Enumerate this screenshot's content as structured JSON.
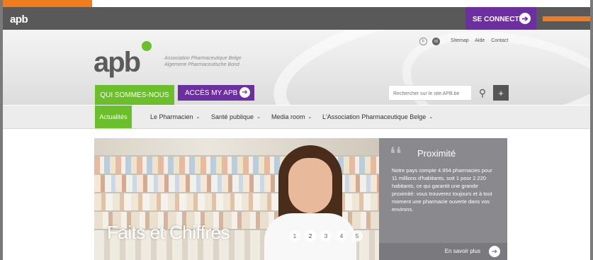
{
  "brand": {
    "short_logo": "apb",
    "logo": "apb",
    "assoc_fr": "Association Pharmaceutique Belge",
    "assoc_nl": "Algemene Pharmaceutische Bond",
    "colors": {
      "green": "#6bbf2a",
      "purple": "#6b2fa0",
      "orange": "#f07c20",
      "dark": "#595959"
    }
  },
  "topbar": {
    "connect_label": "SE CONNECTER",
    "arrow_icon": "arrow-right-icon"
  },
  "header": {
    "lang_fr": "fr",
    "lang_nl": "nl",
    "links": [
      "Sitemap",
      "Aide",
      "Contact"
    ],
    "tab_qui": "QUI SOMMES-NOUS",
    "tab_acces": "ACCÈS MY APB",
    "search_placeholder": "Rechercher sur le site APB.be",
    "plus": "+"
  },
  "nav": {
    "items": [
      {
        "label": "Actualités"
      },
      {
        "label": "Le Pharmacien"
      },
      {
        "label": "Santé publique"
      },
      {
        "label": "Media room"
      },
      {
        "label": "L'Association Pharmaceutique Belge"
      }
    ]
  },
  "hero": {
    "title": "Faits et Chiffres",
    "dots": [
      "1",
      "2",
      "3",
      "4",
      "5"
    ],
    "active_dot": 2
  },
  "info": {
    "quote": "❛❛",
    "title": "Proximité",
    "text": "Notre pays compte 4.954 pharmacies pour 11 millions d'habitants, soit 1 pour 2.220 habitants, ce qui garantit une grande proximité: vous trouverez toujours et à tout moment une pharmacie ouverte dans vos environs.",
    "more_label": "En savoir plus"
  }
}
